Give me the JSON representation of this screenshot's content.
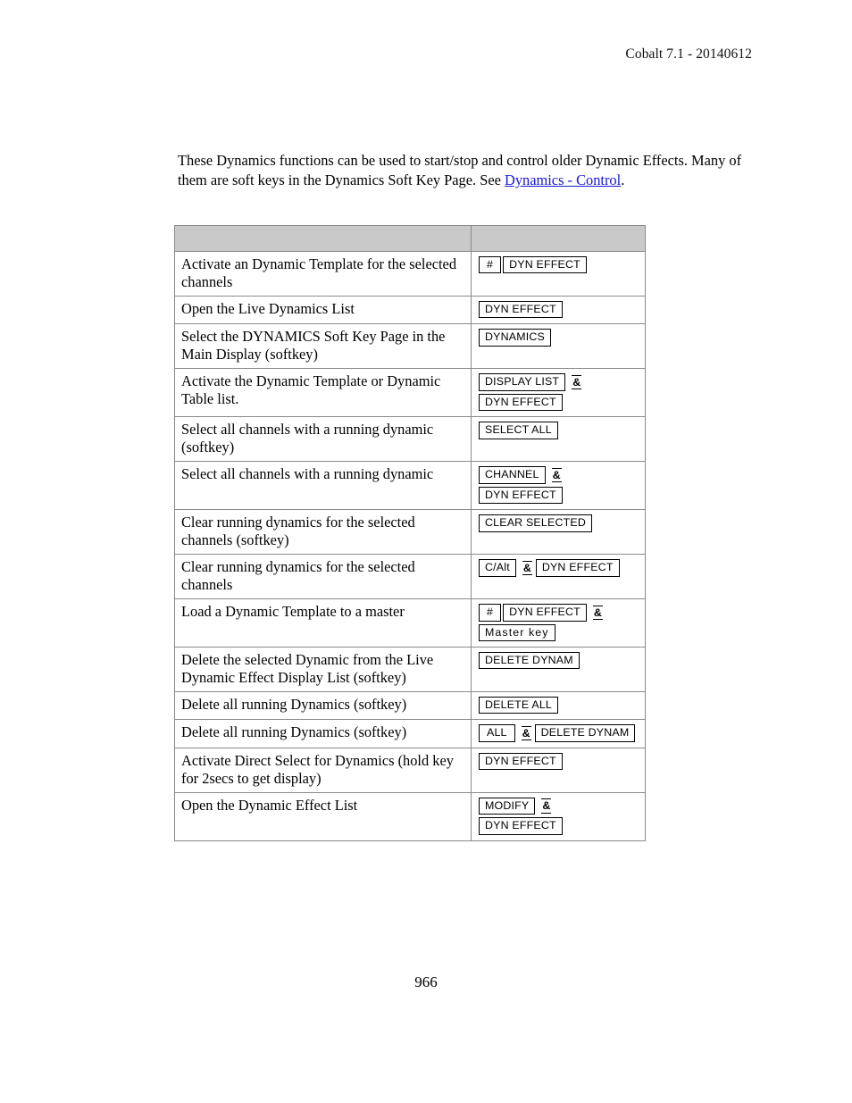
{
  "header": {
    "running_head": "Cobalt 7.1 - 20140612"
  },
  "intro": {
    "text_before_link": "These Dynamics functions can be used to start/stop and control older Dynamic Effects. Many of them are soft keys in the Dynamics Soft Key Page. See ",
    "link_label": "Dynamics - Control",
    "text_after_link": "."
  },
  "table": {
    "header": {
      "col_description": "",
      "col_keys": ""
    },
    "rows": [
      {
        "description": "Activate an Dynamic Template for the selected channels",
        "keylines": [
          {
            "items": [
              {
                "type": "key",
                "label": "#"
              },
              {
                "type": "key",
                "label": "DYN EFFECT"
              }
            ]
          }
        ]
      },
      {
        "description": "Open the Live Dynamics List",
        "keylines": [
          {
            "items": [
              {
                "type": "key",
                "label": "DYN EFFECT"
              }
            ]
          }
        ]
      },
      {
        "description": "Select the DYNAMICS Soft Key Page in the Main Display (softkey)",
        "keylines": [
          {
            "items": [
              {
                "type": "key",
                "label": "DYNAMICS"
              }
            ]
          }
        ]
      },
      {
        "description": "Activate the Dynamic Template or Dynamic Table list.",
        "keylines": [
          {
            "items": [
              {
                "type": "key",
                "label": "DISPLAY LIST"
              },
              {
                "type": "sep",
                "label": "&"
              }
            ]
          },
          {
            "items": [
              {
                "type": "key",
                "label": "DYN EFFECT"
              }
            ]
          }
        ]
      },
      {
        "description": "Select all channels with a running dynamic (softkey)",
        "keylines": [
          {
            "items": [
              {
                "type": "key",
                "label": "SELECT ALL"
              }
            ]
          }
        ]
      },
      {
        "description": "Select all channels with a running dynamic",
        "keylines": [
          {
            "items": [
              {
                "type": "key",
                "label": "CHANNEL"
              },
              {
                "type": "sep",
                "label": "&"
              }
            ]
          },
          {
            "items": [
              {
                "type": "key",
                "label": "DYN EFFECT"
              }
            ]
          }
        ]
      },
      {
        "description": "Clear running dynamics for the selected channels (softkey)",
        "keylines": [
          {
            "items": [
              {
                "type": "key",
                "label": "CLEAR SELECTED"
              }
            ]
          }
        ]
      },
      {
        "description": "Clear running dynamics for the selected channels",
        "keylines": [
          {
            "items": [
              {
                "type": "key",
                "label": "C/Alt"
              },
              {
                "type": "sep",
                "label": "&"
              },
              {
                "type": "key",
                "label": "DYN EFFECT"
              }
            ]
          }
        ]
      },
      {
        "description": "Load a Dynamic Template to a master",
        "keylines": [
          {
            "items": [
              {
                "type": "key",
                "label": "#"
              },
              {
                "type": "key",
                "label": "DYN EFFECT"
              },
              {
                "type": "sep",
                "label": "&"
              }
            ]
          },
          {
            "items": [
              {
                "type": "key",
                "label": "Master key",
                "spaced": true
              }
            ]
          }
        ]
      },
      {
        "description": "Delete the selected Dynamic from the Live Dynamic Effect  Display List (softkey)",
        "keylines": [
          {
            "items": [
              {
                "type": "key",
                "label": "DELETE DYNAM"
              }
            ]
          }
        ]
      },
      {
        "description": "Delete all running Dynamics (softkey)",
        "keylines": [
          {
            "items": [
              {
                "type": "key",
                "label": "DELETE ALL"
              }
            ]
          }
        ]
      },
      {
        "description": "Delete all running Dynamics (softkey)",
        "keylines": [
          {
            "items": [
              {
                "type": "key",
                "label": "ALL"
              },
              {
                "type": "sep",
                "label": "&"
              },
              {
                "type": "key",
                "label": "DELETE DYNAM"
              }
            ]
          }
        ]
      },
      {
        "description": "Activate Direct Select for Dynamics (hold key for 2secs to get display)",
        "keylines": [
          {
            "items": [
              {
                "type": "key",
                "label": "DYN EFFECT"
              }
            ]
          }
        ]
      },
      {
        "description": "Open the Dynamic Effect List",
        "keylines": [
          {
            "items": [
              {
                "type": "key",
                "label": "MODIFY"
              },
              {
                "type": "sep",
                "label": "&"
              }
            ]
          },
          {
            "items": [
              {
                "type": "key",
                "label": "DYN EFFECT"
              }
            ]
          }
        ]
      }
    ]
  },
  "footer": {
    "page_number": "966"
  },
  "colors": {
    "link": "#1818d8",
    "table_header_fill": "#c9c9c9",
    "table_border": "#8a8a8a",
    "key_border": "#000000"
  }
}
